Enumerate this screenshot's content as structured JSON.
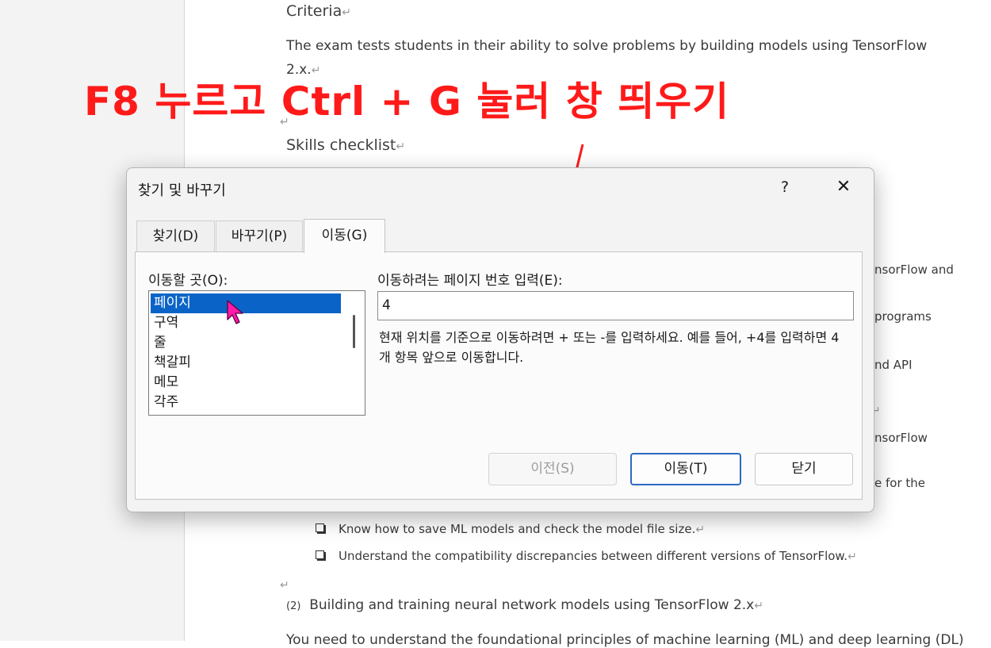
{
  "annotation": {
    "text": "F8 누르고 Ctrl + G  눌러 창 띄우기",
    "color": "#ff1a1a"
  },
  "document": {
    "criteria_heading": "Criteria",
    "para1_line1": "The exam tests students in their ability to solve problems by building models using TensorFlow",
    "para1_line2": "2.x.",
    "skills_heading": "Skills checklist",
    "right_fragments": [
      "nsorFlow and",
      "programs",
      "nd API",
      "nsorFlow",
      "e for the"
    ],
    "bullets": [
      "Know how to save ML models and check the model file size.",
      "Understand the compatibility discrepancies between different versions of TensorFlow."
    ],
    "section_number": "(2)",
    "section_title": "Building and training neural network models using TensorFlow 2.x",
    "bottom_line": "You need to understand the foundational principles of machine learning (ML) and deep learning (DL)",
    "pilcrow": "↵"
  },
  "dialog": {
    "title": "찾기 및 바꾸기",
    "help_label": "?",
    "close_label": "✕",
    "tabs": {
      "find": "찾기(D)",
      "replace": "바꾸기(P)",
      "goto": "이동(G)"
    },
    "goto_what_label": "이동할 곳(O):",
    "goto_items": [
      "페이지",
      "구역",
      "줄",
      "책갈피",
      "메모",
      "각주"
    ],
    "page_number_label": "이동하려는 페이지 번호 입력(E):",
    "page_number_value": "4",
    "hint": "현재 위치를 기준으로 이동하려면 + 또는 -를 입력하세요. 예를 들어, +4를 입력하면 4개 항목 앞으로 이동합니다.",
    "buttons": {
      "previous": "이전(S)",
      "goto": "이동(T)",
      "close": "닫기"
    },
    "accent_color": "#0a64c8"
  }
}
